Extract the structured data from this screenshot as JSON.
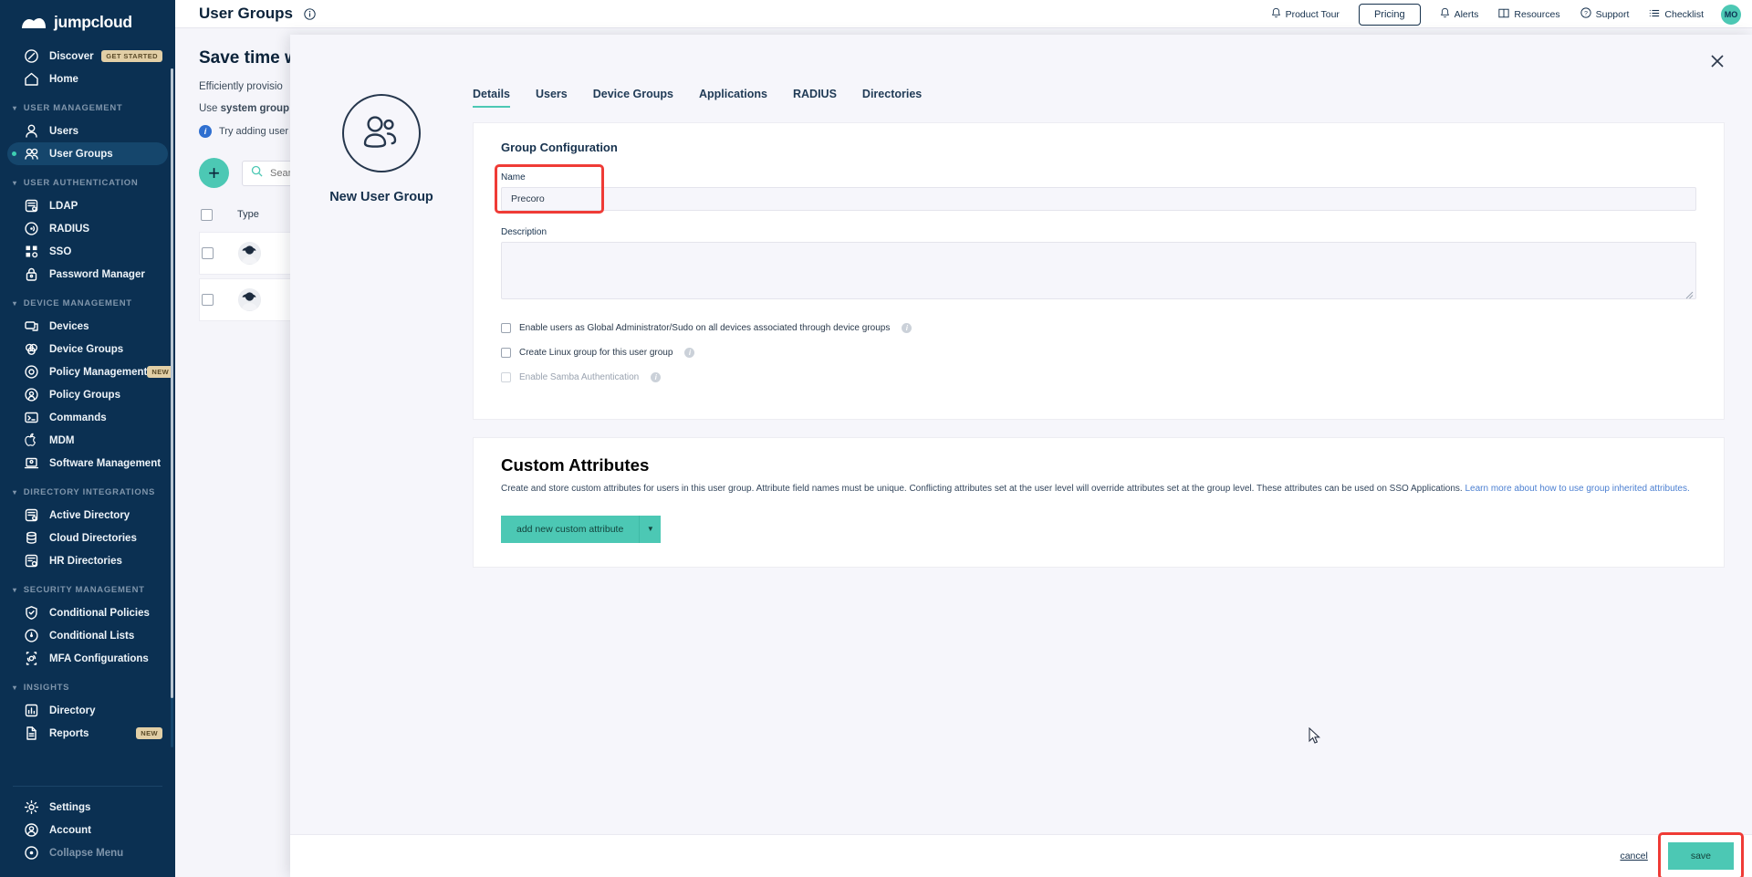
{
  "brand": {
    "name": "jumpcloud",
    "logo_icon": "jumpcloud-cloud-icon"
  },
  "sidebar": {
    "top_items": [
      {
        "label": "Discover",
        "icon": "compass-icon",
        "badge": "GET STARTED",
        "selected": false
      },
      {
        "label": "Home",
        "icon": "home-icon",
        "badge": "",
        "selected": false
      }
    ],
    "sections": [
      {
        "title": "USER MANAGEMENT",
        "items": [
          {
            "label": "Users",
            "icon": "user-icon",
            "badge": "",
            "selected": false
          },
          {
            "label": "User Groups",
            "icon": "user-group-icon",
            "badge": "",
            "selected": true
          }
        ]
      },
      {
        "title": "USER AUTHENTICATION",
        "items": [
          {
            "label": "LDAP",
            "icon": "server-icon",
            "badge": "",
            "selected": false
          },
          {
            "label": "RADIUS",
            "icon": "radius-signal-icon",
            "badge": "",
            "selected": false
          },
          {
            "label": "SSO",
            "icon": "grid-apps-icon",
            "badge": "",
            "selected": false
          },
          {
            "label": "Password Manager",
            "icon": "lock-icon",
            "badge": "",
            "selected": false
          }
        ]
      },
      {
        "title": "DEVICE MANAGEMENT",
        "items": [
          {
            "label": "Devices",
            "icon": "monitor-icon",
            "badge": "",
            "selected": false
          },
          {
            "label": "Device Groups",
            "icon": "device-group-icon",
            "badge": "",
            "selected": false
          },
          {
            "label": "Policy Management",
            "icon": "policy-target-icon",
            "badge": "NEW",
            "selected": false
          },
          {
            "label": "Policy Groups",
            "icon": "policy-group-icon",
            "badge": "",
            "selected": false
          },
          {
            "label": "Commands",
            "icon": "terminal-icon",
            "badge": "",
            "selected": false
          },
          {
            "label": "MDM",
            "icon": "apple-icon",
            "badge": "",
            "selected": false
          },
          {
            "label": "Software Management",
            "icon": "laptop-icon",
            "badge": "",
            "selected": false
          }
        ]
      },
      {
        "title": "DIRECTORY INTEGRATIONS",
        "items": [
          {
            "label": "Active Directory",
            "icon": "server-icon",
            "badge": "",
            "selected": false
          },
          {
            "label": "Cloud Directories",
            "icon": "cloud-database-icon",
            "badge": "",
            "selected": false
          },
          {
            "label": "HR Directories",
            "icon": "server-clock-icon",
            "badge": "",
            "selected": false
          }
        ]
      },
      {
        "title": "SECURITY MANAGEMENT",
        "items": [
          {
            "label": "Conditional Policies",
            "icon": "shield-icon",
            "badge": "",
            "selected": false
          },
          {
            "label": "Conditional Lists",
            "icon": "list-circle-icon",
            "badge": "",
            "selected": false
          },
          {
            "label": "MFA Configurations",
            "icon": "fingerprint-icon",
            "badge": "",
            "selected": false
          }
        ]
      },
      {
        "title": "INSIGHTS",
        "items": [
          {
            "label": "Directory",
            "icon": "bar-chart-icon",
            "badge": "",
            "selected": false
          },
          {
            "label": "Reports",
            "icon": "document-icon",
            "badge": "NEW",
            "selected": false
          }
        ]
      }
    ],
    "bottom_items": [
      {
        "label": "Settings",
        "icon": "gear-icon",
        "dim": false
      },
      {
        "label": "Account",
        "icon": "account-circle-icon",
        "dim": false
      },
      {
        "label": "Collapse Menu",
        "icon": "collapse-icon",
        "dim": true
      }
    ]
  },
  "header": {
    "title": "User Groups",
    "info_icon": "info-circle-icon",
    "product_tour": "Product Tour",
    "product_tour_icon": "bell-icon",
    "pricing": "Pricing",
    "alerts": "Alerts",
    "alerts_icon": "bell-icon",
    "resources": "Resources",
    "resources_icon": "book-icon",
    "support": "Support",
    "support_icon": "question-circle-icon",
    "checklist": "Checklist",
    "checklist_icon": "list-icon",
    "avatar_initials": "MO",
    "avatar_color": "#4cc8b4"
  },
  "promo": {
    "heading": "Save time w",
    "line1": "Efficiently provisio",
    "line2_prefix": "Use ",
    "line2_bold": "system group",
    "note": "Try adding user"
  },
  "table": {
    "add_button_icon": "plus-icon",
    "search_placeholder": "Sear",
    "search_icon": "search-icon",
    "search_value": "",
    "columns": [
      "Type"
    ],
    "rows": [
      {
        "avatar": "user-group-avatar",
        "name": "",
        "sub": ""
      },
      {
        "avatar": "user-group-avatar",
        "name": "",
        "sub": ""
      }
    ]
  },
  "modal": {
    "close_icon": "close-icon",
    "group_icon": "user-group-icon",
    "caption": "New User Group",
    "tabs": [
      {
        "label": "Details",
        "active": true
      },
      {
        "label": "Users",
        "active": false
      },
      {
        "label": "Device Groups",
        "active": false
      },
      {
        "label": "Applications",
        "active": false
      },
      {
        "label": "RADIUS",
        "active": false
      },
      {
        "label": "Directories",
        "active": false
      }
    ],
    "group_configuration": {
      "title": "Group Configuration",
      "name_label": "Name",
      "name_value": "Precoro",
      "name_placeholder": "",
      "name_highlight_color": "#ef3b36",
      "description_label": "Description",
      "description_value": "",
      "description_placeholder": "",
      "checkboxes": [
        {
          "label": "Enable users as Global Administrator/Sudo on all devices associated through device groups",
          "checked": false,
          "disabled": false,
          "help_icon": "info-icon"
        },
        {
          "label": "Create Linux group for this user group",
          "checked": false,
          "disabled": false,
          "help_icon": "info-icon"
        },
        {
          "label": "Enable Samba Authentication",
          "checked": false,
          "disabled": true,
          "help_icon": "info-icon"
        }
      ]
    },
    "custom_attributes": {
      "title": "Custom Attributes",
      "description_part1": "Create and store custom attributes for users in this user group. Attribute field names must be unique. Conflicting attributes set at the user level will override attributes set at the group level. These attributes can be used on SSO Applications. ",
      "link_text": "Learn more about how to use group inherited attributes.",
      "add_button": "add new custom attribute",
      "add_button_caret": "caret-down-icon",
      "accent_color": "#4cc8b4"
    },
    "footer": {
      "cancel": "cancel",
      "save": "save",
      "save_highlight_color": "#ef3b36"
    }
  }
}
